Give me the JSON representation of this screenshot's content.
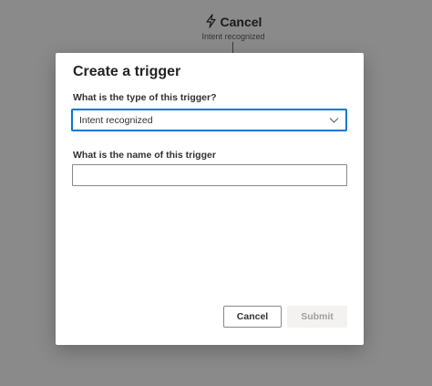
{
  "background": {
    "node_title": "Cancel",
    "node_subtitle": "Intent recognized",
    "node_icon": "lightning-bolt-icon"
  },
  "dialog": {
    "title": "Create a trigger",
    "type_field": {
      "label": "What is the type of this trigger?",
      "selected_value": "Intent recognized",
      "icon": "chevron-down-icon"
    },
    "name_field": {
      "label": "What is the name of this trigger",
      "value": "",
      "placeholder": ""
    },
    "buttons": {
      "cancel_label": "Cancel",
      "submit_label": "Submit",
      "submit_disabled": true
    }
  },
  "colors": {
    "overlay": "#8a8a8a",
    "accent": "#0078d4",
    "disabled_bg": "#f3f2f1",
    "disabled_text": "#a19f9d"
  }
}
